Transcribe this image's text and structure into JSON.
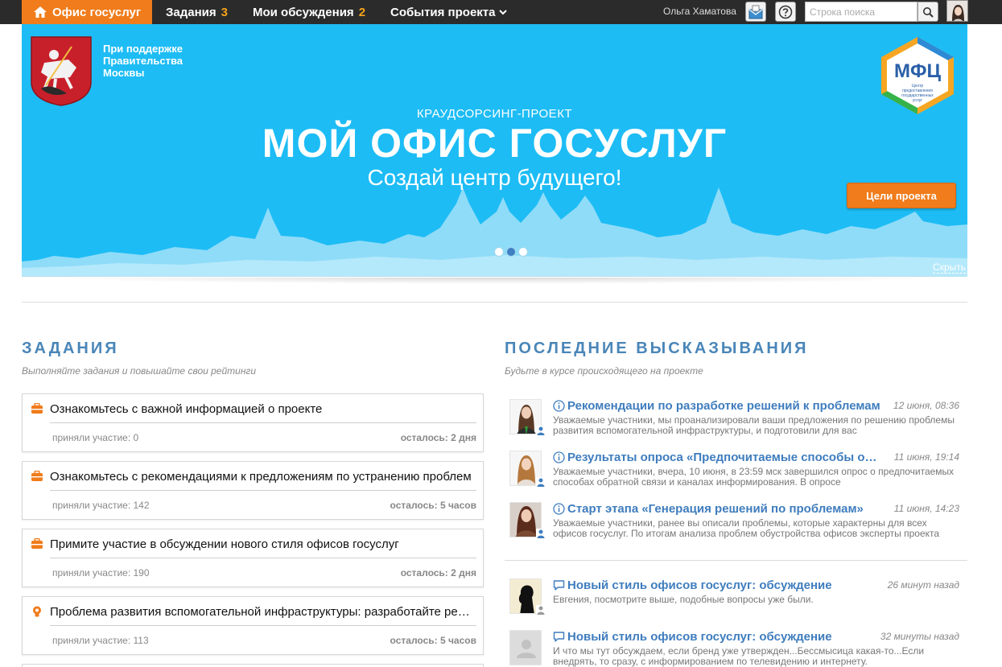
{
  "nav": {
    "home_label": "Офис госуслуг",
    "tasks_label": "Задания",
    "tasks_count": "3",
    "discussions_label": "Мои обсуждения",
    "discussions_count": "2",
    "events_label": "События проекта",
    "user_name": "Ольга Хаматова",
    "search_placeholder": "Строка поиска"
  },
  "banner": {
    "support_lines": [
      "При поддержке",
      "Правительства",
      "Москвы"
    ],
    "logo_text": "МФЦ",
    "logo_subtext": "Центр предоставления государственных услуг",
    "kicker": "КРАУДСОРСИНГ-ПРОЕКТ",
    "headline": "МОЙ ОФИС ГОСУСЛУГ",
    "tagline": "Создай центр будущего!",
    "goals_button": "Цели проекта",
    "hide_link": "Скрыть",
    "slides_total": 3,
    "slide_active": 2
  },
  "tasks": {
    "title": "ЗАДАНИЯ",
    "subtitle": "Выполняйте задания и повышайте свои рейтинги",
    "items": [
      {
        "icon": "briefcase-icon",
        "title": "Ознакомьтесь с важной информацией о проекте",
        "participants": "приняли участие: 0",
        "remaining": "осталось: 2 дня"
      },
      {
        "icon": "briefcase-icon",
        "title": "Ознакомьтесь с рекомендациями к предложениям по устранению проблем",
        "participants": "приняли участие: 142",
        "remaining": "осталось: 5 часов"
      },
      {
        "icon": "briefcase-icon",
        "title": "Примите участие в обсуждении нового стиля офисов госуслуг",
        "participants": "приняли участие: 190",
        "remaining": "осталось: 2 дня"
      },
      {
        "icon": "lightbulb-icon",
        "title": "Проблема развития вспомогательной инфраструктуры: разработайте решения",
        "participants": "приняли участие: 113",
        "remaining": "осталось: 5 часов"
      }
    ]
  },
  "statements": {
    "title": "ПОСЛЕДНИЕ ВЫСКАЗЫВАНИЯ",
    "subtitle": "Будьте в курсе происходящего на проекте",
    "items": [
      {
        "type": "info-icon",
        "title": "Рекомендации по разработке решений к проблемам",
        "time": "12 июня, 08:36",
        "text": "Уважаемые участники, мы проанализировали ваши предложения по решению проблемы развития вспомогательной инфраструктуры, и подготовили для вас"
      },
      {
        "type": "info-icon",
        "title": "Результаты опроса «Предпочитаемые способы обратной связи»",
        "time": "11 июня, 19:14",
        "text": "Уважаемые участники, вчера, 10 июня, в 23:59 мск завершился опрос о предпочитаемых способах обратной связи и каналах информирования. В опросе"
      },
      {
        "type": "info-icon",
        "title": "Старт этапа «Генерация решений по проблемам»",
        "time": "11 июня, 14:23",
        "text": "Уважаемые участники, ранее вы описали проблемы, которые характерны для всех офисов госуслуг. По итогам анализа проблем обустройства офисов эксперты проекта"
      },
      {
        "type": "comment-icon",
        "title": "Новый стиль офисов госуслуг: обсуждение",
        "time": "26 минут назад",
        "text": "Евгения, посмотрите выше, подобные вопросы уже были."
      },
      {
        "type": "comment-icon",
        "title": "Новый стиль офисов госуслуг: обсуждение",
        "time": "32 минуты назад",
        "text": "И что мы тут обсуждаем, если бренд уже утвержден...Бессмысица какая-то...Если внедрять, то сразу, с информированием по телевидению и интернету."
      }
    ]
  },
  "colors": {
    "accent_orange": "#f07c1b",
    "banner_blue": "#1dbcf5",
    "heading_blue": "#4a86b8",
    "link_blue": "#3f7dbe",
    "count_yellow": "#f7a41c"
  }
}
